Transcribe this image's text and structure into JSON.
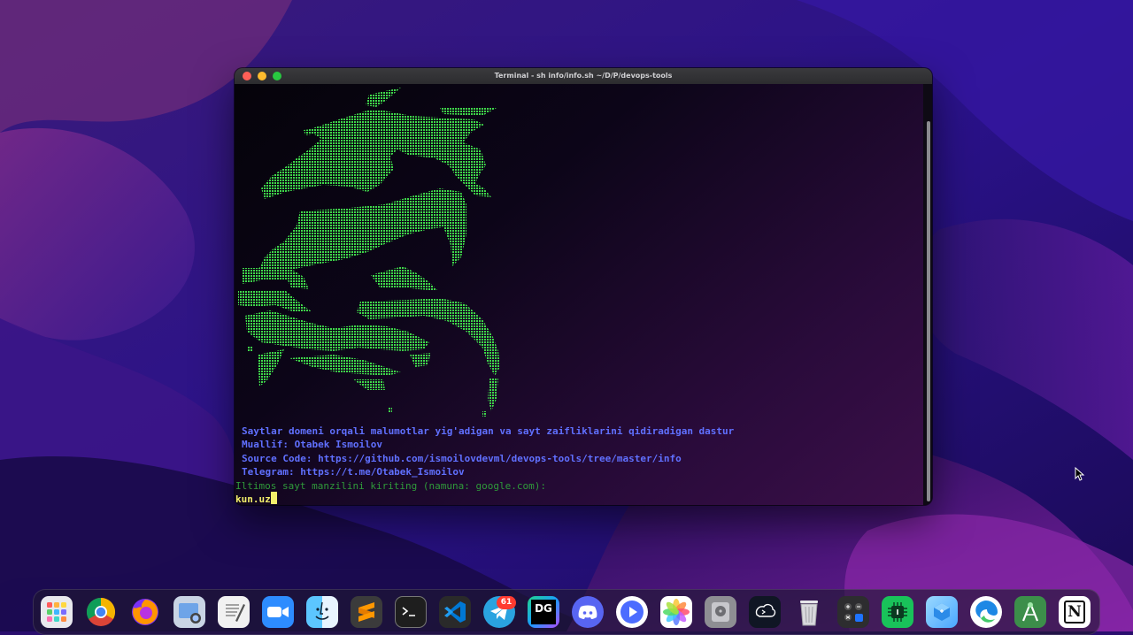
{
  "window": {
    "title": "Terminal - sh info/info.sh ~/D/P/devops-tools"
  },
  "terminal": {
    "description": "Saytlar domeni orqali malumotlar yig'adigan va sayt zaifliklarini qidiradigan dastur",
    "author": "Muallif: Otabek Ismoilov",
    "source": "Source Code: https://github.com/ismoilovdevml/devops-tools/tree/master/info",
    "telegram": "Telegram: https://t.me/Otabek_Ismoilov",
    "prompt": "Iltimos sayt manzilini kiriting (namuna: google.com):",
    "input_value": "kun.uz",
    "ascii_art": "green-dragon-ascii-art"
  },
  "dock": {
    "apps": [
      {
        "name": "Launchpad",
        "icon": "launchpad-icon"
      },
      {
        "name": "Google Chrome",
        "icon": "chrome-icon"
      },
      {
        "name": "Firefox",
        "icon": "firefox-icon"
      },
      {
        "name": "Preview",
        "icon": "preview-icon"
      },
      {
        "name": "TextEdit",
        "icon": "textedit-icon"
      },
      {
        "name": "Zoom",
        "icon": "zoom-icon"
      },
      {
        "name": "Finder",
        "icon": "finder-icon"
      },
      {
        "name": "Sublime Text",
        "icon": "sublime-icon"
      },
      {
        "name": "Terminal",
        "icon": "terminal-icon"
      },
      {
        "name": "Visual Studio Code",
        "icon": "vscode-icon"
      },
      {
        "name": "Telegram",
        "icon": "telegram-icon",
        "badge": "61"
      },
      {
        "name": "DataGrip",
        "icon": "datagrip-icon",
        "label": "DG"
      },
      {
        "name": "Discord",
        "icon": "discord-icon"
      },
      {
        "name": "Infuse",
        "icon": "play-icon"
      },
      {
        "name": "Photos",
        "icon": "photos-icon"
      },
      {
        "name": "Disk Utility",
        "icon": "disk-utility-icon"
      },
      {
        "name": "Warp",
        "icon": "warp-icon"
      },
      {
        "name": "Trash",
        "icon": "trash-icon"
      },
      {
        "name": "Calculator",
        "icon": "calculator-icon"
      },
      {
        "name": "iStat Menus",
        "icon": "chip-icon"
      },
      {
        "name": "Xcode Cloud",
        "icon": "cube-icon"
      },
      {
        "name": "Microsoft Edge",
        "icon": "edge-icon"
      },
      {
        "name": "Android Studio",
        "icon": "android-studio-icon"
      },
      {
        "name": "Notion",
        "icon": "notion-icon",
        "label": "N"
      }
    ]
  },
  "colors": {
    "terminal_text_blue": "#6070ff",
    "prompt_green": "#2f9a3a",
    "input_yellow": "#f3ef6b",
    "art_green": "#3fd84a"
  }
}
